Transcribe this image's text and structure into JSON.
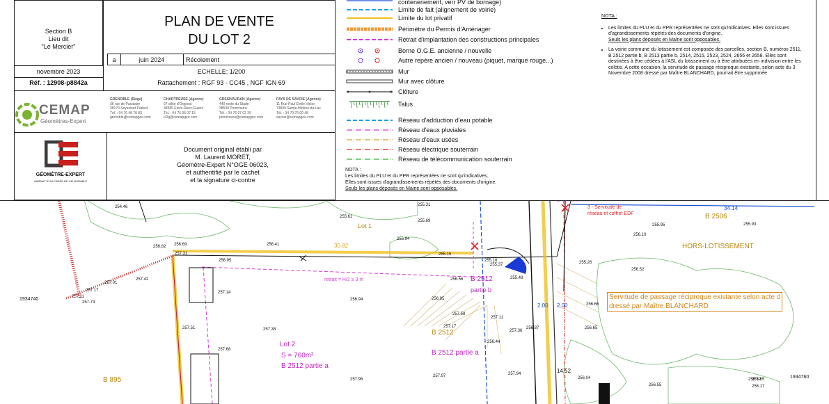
{
  "title": {
    "line1": "PLAN DE VENTE",
    "line2": "DU LOT 2"
  },
  "location": {
    "section": "Section B",
    "lieu_dit": "Lieu dit",
    "name": "\"Le Mercier\""
  },
  "date": "novembre 2023",
  "reference": "Réf. : 12908-p8842a",
  "revision": {
    "index": "a",
    "date": "juin 2024",
    "label": "Récolement"
  },
  "scale": "ECHELLE: 1/200",
  "rattachement": "Rattachement : RGF 93 - CC45 , NGF IGN 69",
  "company": {
    "name": "CEMAP",
    "subtitle": "Géomètres-Expert"
  },
  "agencies": [
    {
      "name": "GRENOBLE (Siège)",
      "address": "36 rue de Pacalaire\n38170 Seyssinet-Pariset",
      "phone": "Tél. : 04 76 48 70 83",
      "email": "grenoble@cemapgeo.com"
    },
    {
      "name": "CHARTREUSE (Agence)",
      "address": "97 allée d'Orgeval\n38380 Entre-Deux-Guiers",
      "phone": "Tél. : 04 76 66 07 15",
      "email": "cl2g@cemapgeo.com"
    },
    {
      "name": "GRESIVAUDAN (Agence)",
      "address": "440 route du Stade\n38530 Pontcharra",
      "phone": "Tél. : 04 76 97 02 20",
      "email": "pontcharra@cemapgeo.com"
    },
    {
      "name": "PAYS DE SAVOIE (Agence)",
      "address": "11 Rue Paul Emile Victor\n73800 Sainte-Hélène-du-Lac",
      "phone": "Tél. : 04 79 70 00 48",
      "email": "savoie@cemapgeo.com"
    }
  ],
  "geometre_logo": {
    "name": "GÉOMÈTRE-EXPERT",
    "tagline": "GARANT D'UN CADRE DE VIE DURABLE"
  },
  "certification": [
    "Document original établi par",
    "M. Laurent MORET,",
    "Géomètre-Expert N°OGE 06023,",
    "et authentifié par le cachet",
    "et la signature ci-contre"
  ],
  "legend": [
    {
      "label": "contenenement, verr PV de bornage)",
      "color": "#1a4fd6",
      "style": "top"
    },
    {
      "label": "Limite de fait (alignement de voirie)",
      "color": "#1aa0e0",
      "style": "dash"
    },
    {
      "label": "Limite du lot privatif",
      "color": "#f0c020",
      "style": "solid"
    },
    {
      "label": "Périmètre du Permis d'Aménager",
      "color": "#f39a3a",
      "style": "thick"
    },
    {
      "label": "Retrait d'implantation des constructions principales",
      "color": "#d63ad6",
      "style": "dash"
    },
    {
      "label": "Borne O.G.E. ancienne / nouvelle",
      "color": "#6a3ad6",
      "style": "borne"
    },
    {
      "label": "Autre repère ancien / nouveau (piquet, marque rouge...)",
      "color": "#6a3ad6",
      "style": "circle"
    },
    {
      "label": "Mur",
      "color": "#333333",
      "style": "wall"
    },
    {
      "label": "Mur avec clôture",
      "color": "#333333",
      "style": "wall2"
    },
    {
      "label": "Clôture",
      "color": "#333333",
      "style": "fence"
    },
    {
      "label": "Talus",
      "color": "#3a8a3a",
      "style": "talus"
    },
    {
      "label": "Réseau d'adduction d'eau potable",
      "color": "#1aa0e0",
      "style": "dash"
    },
    {
      "label": "Réseau d'eaux pluviales",
      "color": "#d63ad6",
      "style": "dashdot"
    },
    {
      "label": "Réseau d'eaux usées",
      "color": "#d6a020",
      "style": "dashdot"
    },
    {
      "label": "Réseau électrique souterrain",
      "color": "#e02020",
      "style": "dashdot"
    },
    {
      "label": "Réseau de télécommunication souterrain",
      "color": "#30b030",
      "style": "dashdot"
    }
  ],
  "legend_note": {
    "title": "NOTA :",
    "line1": "Les limites du PLU et du PPR représentées ne sont qu'indicatives.",
    "line2": "Elles sont issues d'agrandissements répétés des documents d'origine.",
    "line3": "Seuls les plans déposés en Mairie sont opposables."
  },
  "right_note": {
    "title": "NOTA :",
    "bullet1": "Les limites du PLU et du PPR représentées ne sont qu'indicatives. Elles sont issues d'agrandissements répétés des documents d'origine.",
    "bullet1_u": "Seuls les plans déposés en Mairie sont opposables.",
    "bullet2": "La voirie commune du lotissement est composée des parcelles, section B, numéros 2511, B 2512 partie b, B 2513 partie b, 2514, 2515, 2523, 2524, 2656 et 2658. Elles sont destinées à être cédées à l'ASL du lotissement ou à être attribuées en indivision entre les colotis. A cette occasion, la servitude de passage réciproque existante, selon acte du 3 Novembre 2008 dressé par Maître BLANCHARD, pourrait être supprimée"
  },
  "map": {
    "lot1": "Lot 1",
    "lot2": "Lot 2",
    "lot2_area": "S = 760m²",
    "lot2_parcel": "B 2512 partie a",
    "parcel_b2512": "B 2512",
    "parcel_b2512_pa": "B 2512 partie a",
    "b2512_partb": "B 2512",
    "partie_b": "partie b",
    "b895": "B 895",
    "b2506": "B 2506",
    "hors_lotissement": "HORS-LOTISSEMENT",
    "servitude_edf1": "3 - Servitude de",
    "servitude_edf2": "réseau et coffret EDF",
    "servitude_passage1": "Servitude de passage réciproque existante selon acte d",
    "servitude_passage2": "dressé par Maître BLANCHARD",
    "retrait": "retrait = H/2 ≥ 3 m",
    "dims": {
      "d3082": "30.82",
      "d3414": "34.14",
      "d1452": "14.52",
      "d200a": "2.00",
      "d200b": "2.00",
      "d1936": "1934740",
      "d1934760": "1934760"
    },
    "alts": [
      "254.46",
      "255.61",
      "255.31",
      "255.69",
      "255.94",
      "256.41",
      "256.69",
      "256.82",
      "256.95",
      "257.31",
      "255.15",
      "255.16",
      "255.37",
      "255.48",
      "256.56",
      "256.94",
      "256.85",
      "257.14",
      "257.42",
      "257.01",
      "257.17",
      "257.11",
      "257.74",
      "257.38",
      "257.51",
      "257.68",
      "257.96",
      "257.97",
      "257.94",
      "257.17",
      "257.36",
      "257.11",
      "255.95",
      "255.93",
      "256.10",
      "255.26",
      "256.52",
      "256.66",
      "256.04",
      "256.55",
      "256.17",
      "256.12",
      "255.65",
      "256.44",
      "257.58",
      "256.87",
      "256.65"
    ]
  }
}
